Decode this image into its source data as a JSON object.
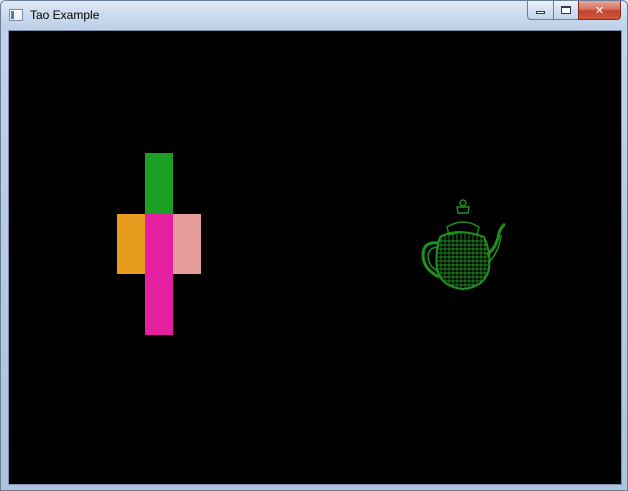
{
  "window": {
    "title": "Tao Example",
    "caption_buttons": {
      "minimize": "minimize",
      "maximize": "maximize",
      "close": "✕"
    }
  },
  "scene": {
    "background_color": "#000000",
    "cross_shape": {
      "top_color": "#1a9e23",
      "left_color": "#e89c1f",
      "center_color": "#e41fa0",
      "right_color": "#e59c9c",
      "bottom_color": "#e41fa0"
    },
    "teapot": {
      "render_style": "wireframe",
      "color": "#1f8f1f"
    }
  }
}
